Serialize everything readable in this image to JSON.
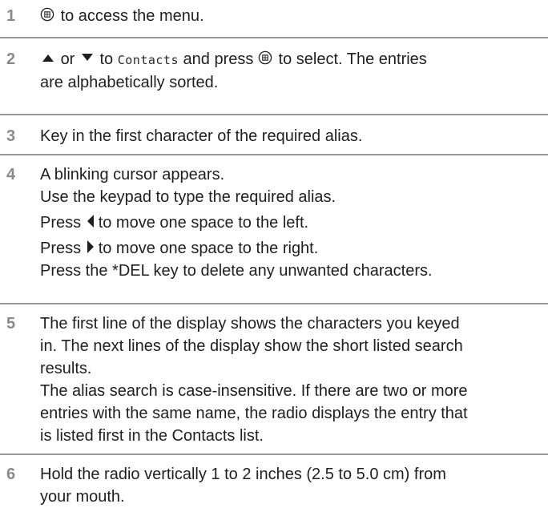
{
  "steps": [
    {
      "number": "1",
      "text_after_icon": "to access the menu."
    },
    {
      "number": "2",
      "or": "or",
      "to": "to",
      "menu_target": "Contacts",
      "press_text": "and press",
      "select_text": "to select. The entries",
      "line2": "are alphabetically sorted."
    },
    {
      "number": "3",
      "text": "Key in the first character of the required alias."
    },
    {
      "number": "4",
      "line1": "A blinking cursor appears.",
      "line2": "Use the keypad to type the required alias.",
      "press_word": "Press",
      "left_text": "to move one space to the left.",
      "right_text": "to move one space to the right.",
      "line5": "Press the *DEL key to delete any unwanted characters."
    },
    {
      "number": "5",
      "lines": [
        "The first line of the display shows the characters you keyed",
        "in. The next lines of the display show the short listed search",
        "results.",
        "The alias search is case-insensitive. If there are two or more",
        "entries with the same name, the radio displays the entry that",
        "is listed first in the Contacts list."
      ]
    },
    {
      "number": "6",
      "lines": [
        "Hold the radio vertically 1 to 2 inches (2.5 to 5.0 cm) from",
        "your mouth."
      ]
    }
  ],
  "icons": {
    "menu": "menu-ok-button-icon",
    "up": "up-arrow-icon",
    "down": "down-arrow-icon",
    "left": "left-arrow-icon",
    "right": "right-arrow-icon"
  },
  "colors": {
    "step_number": "#8a8a8a",
    "divider": "#9a9a9a",
    "text": "#1f1f1f"
  }
}
